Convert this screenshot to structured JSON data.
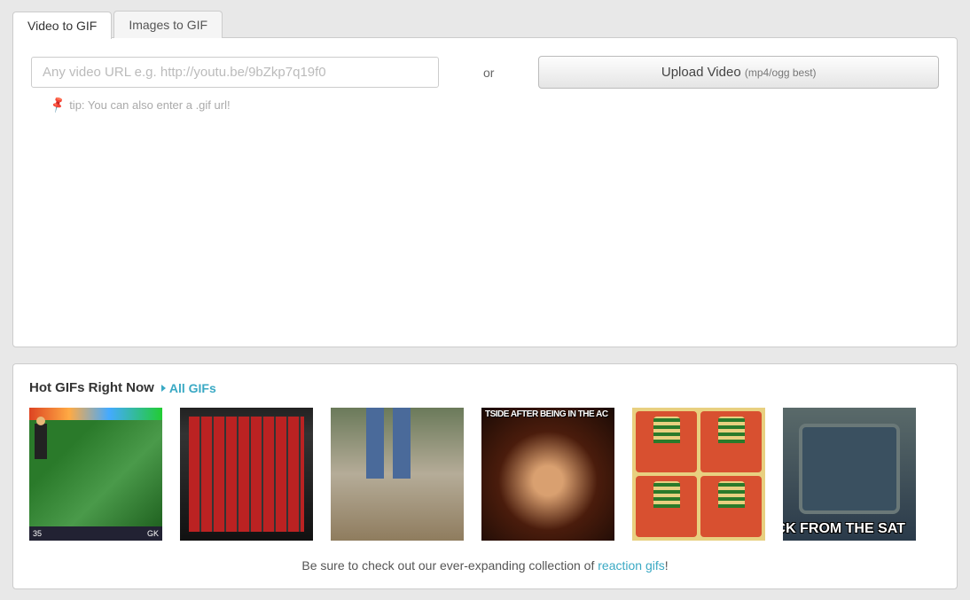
{
  "tabs": {
    "video": "Video to GIF",
    "images": "Images to GIF"
  },
  "url_placeholder": "Any video URL e.g. http://youtu.be/9bZkp7q19f0",
  "or_text": "or",
  "upload": {
    "label": "Upload Video ",
    "note": "(mp4/ogg best)"
  },
  "tip_text": "tip: You can also enter a .gif url!",
  "hot": {
    "title": "Hot GIFs Right Now",
    "all_link": "All GIFs"
  },
  "gifs": [
    {
      "caption_top": "",
      "caption_bottom_left": "35",
      "caption_bottom_right": "GK"
    },
    {
      "caption_top": "",
      "caption_bottom": ""
    },
    {
      "caption_top": "",
      "caption_bottom": ""
    },
    {
      "caption_top": "TSIDE AFTER BEING IN THE AC",
      "caption_bottom": ""
    },
    {
      "caption_top": "",
      "caption_bottom": ""
    },
    {
      "caption_top": "",
      "caption_bottom": "ACK FROM THE SAT"
    }
  ],
  "footer": {
    "prefix": "Be sure to check out our ever-expanding collection of ",
    "link": "reaction gifs",
    "suffix": "!"
  }
}
